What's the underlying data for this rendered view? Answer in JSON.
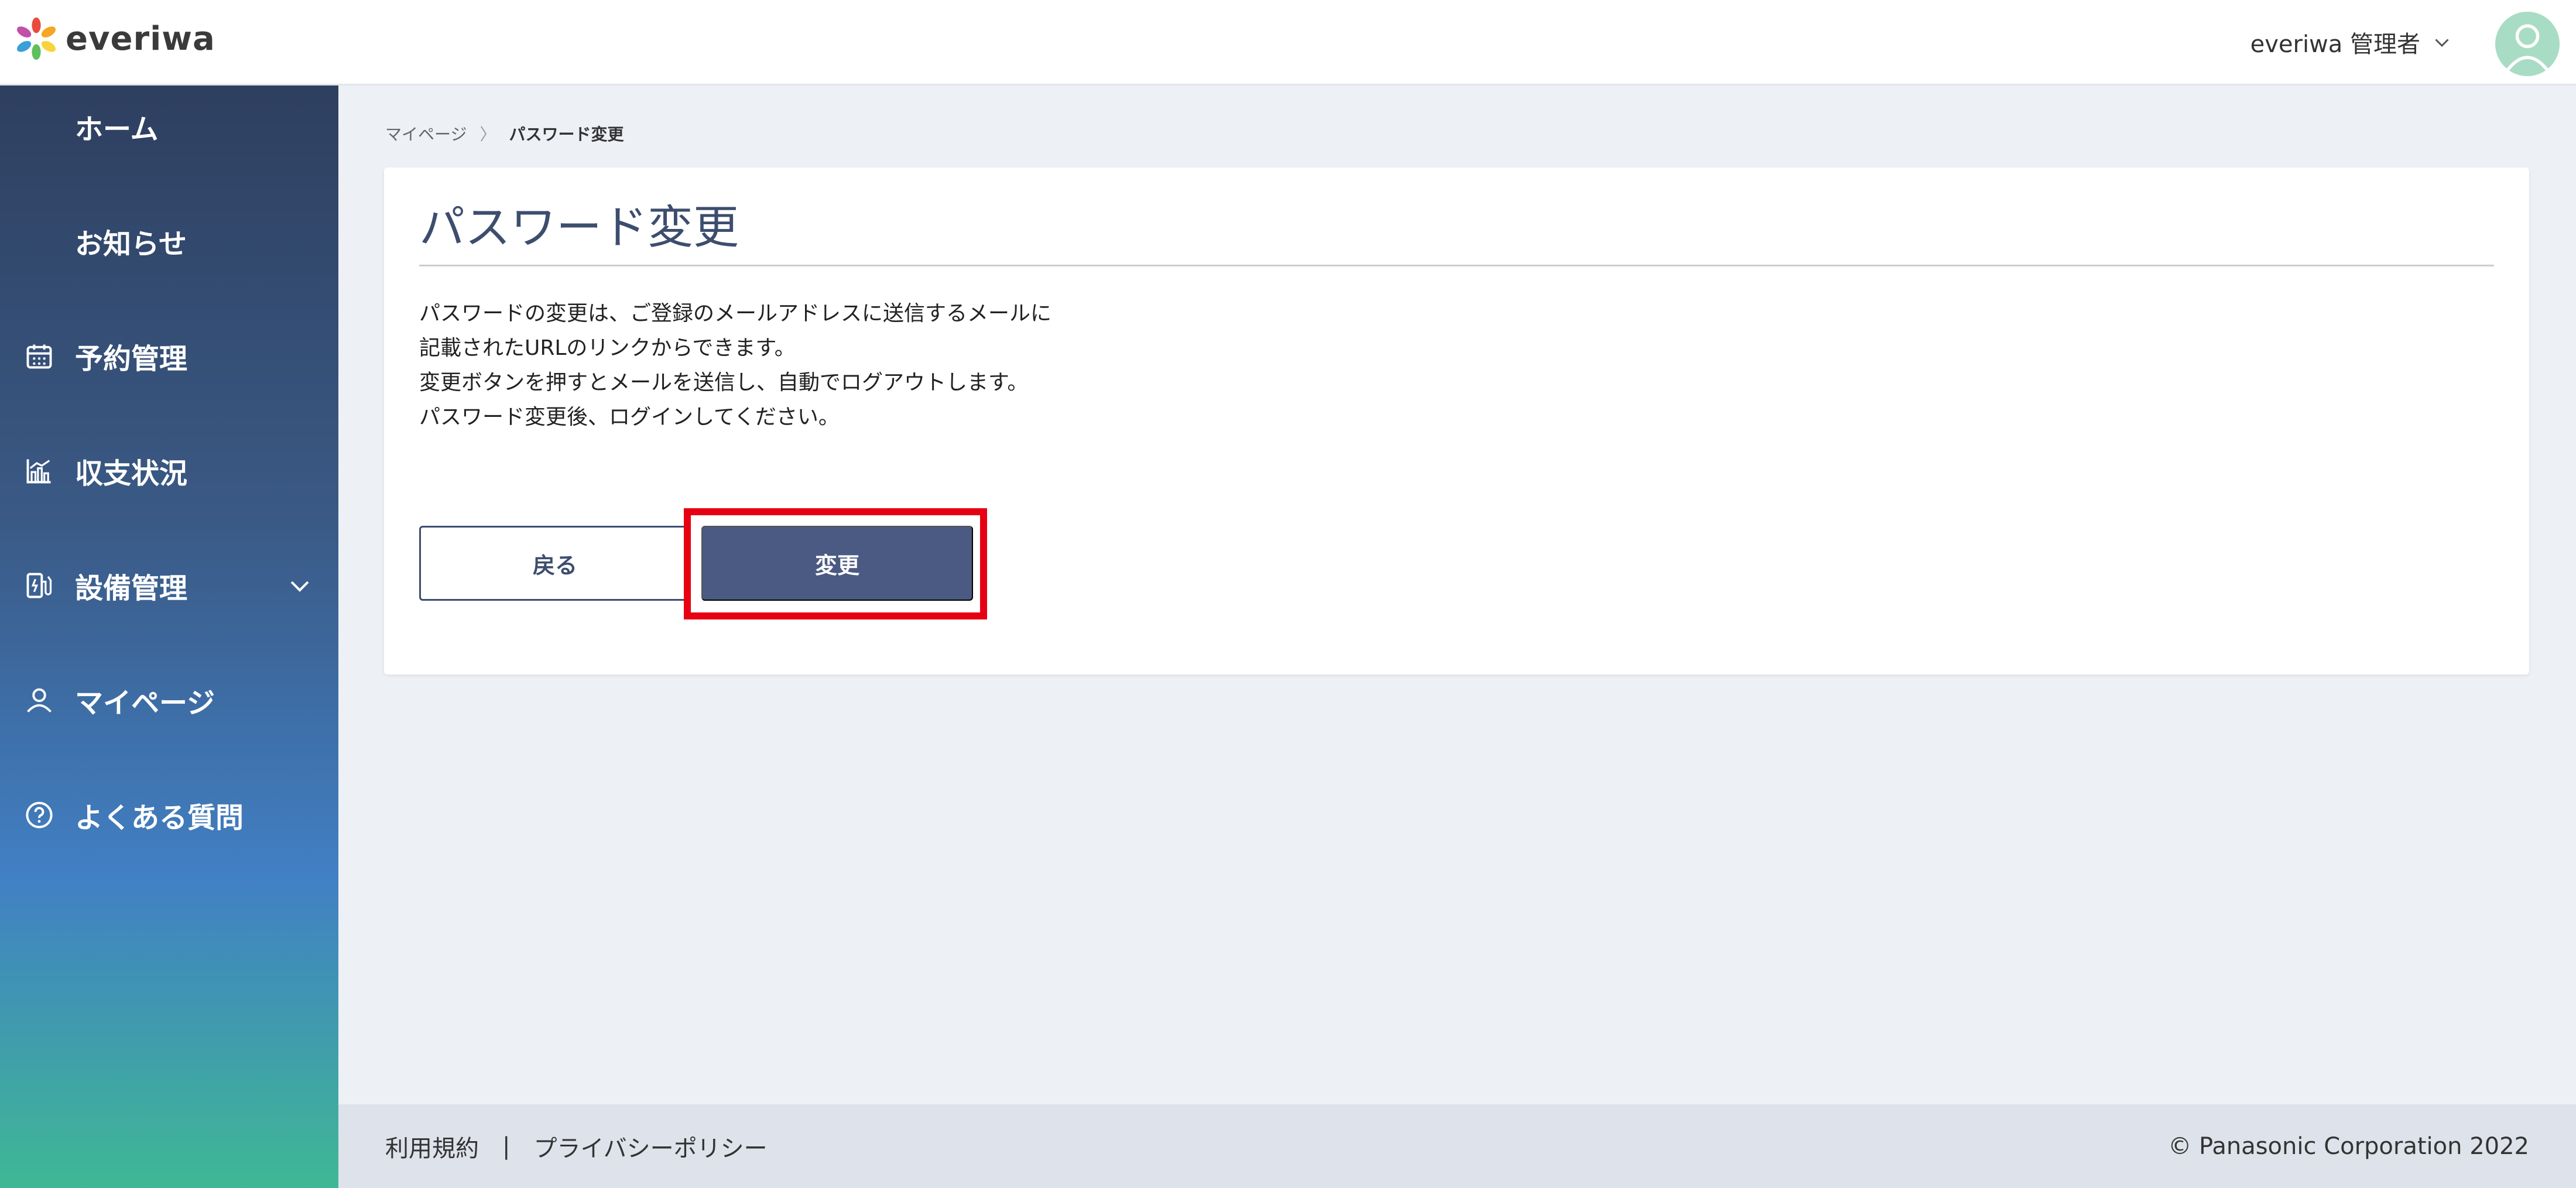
{
  "header": {
    "logo_text": "everiwa",
    "user_name": "everiwa 管理者"
  },
  "sidebar": {
    "items": [
      {
        "label": "ホーム",
        "icon": "none"
      },
      {
        "label": "お知らせ",
        "icon": "none"
      },
      {
        "label": "予約管理",
        "icon": "calendar-icon"
      },
      {
        "label": "収支状況",
        "icon": "chart-icon"
      },
      {
        "label": "設備管理",
        "icon": "charger-icon",
        "has_submenu": true
      },
      {
        "label": "マイページ",
        "icon": "user-icon"
      },
      {
        "label": "よくある質問",
        "icon": "help-icon"
      }
    ]
  },
  "breadcrumb": {
    "parent": "マイページ",
    "separator": "〉",
    "current": "パスワード変更"
  },
  "main": {
    "title": "パスワード変更",
    "description": [
      "パスワードの変更は、ご登録のメールアドレスに送信するメールに",
      "記載されたURLのリンクからできます。",
      "変更ボタンを押すとメールを送信し、自動でログアウトします。",
      "パスワード変更後、ログインしてください。"
    ],
    "back_label": "戻る",
    "change_label": "変更"
  },
  "footer": {
    "terms": "利用規約",
    "separator": "|",
    "privacy": "プライバシーポリシー",
    "copyright": "© Panasonic Corporation 2022"
  },
  "colors": {
    "accent": "#4a5a82",
    "title": "#3d4d6e",
    "highlight": "#e60012",
    "avatar": "#a9dcc4"
  }
}
